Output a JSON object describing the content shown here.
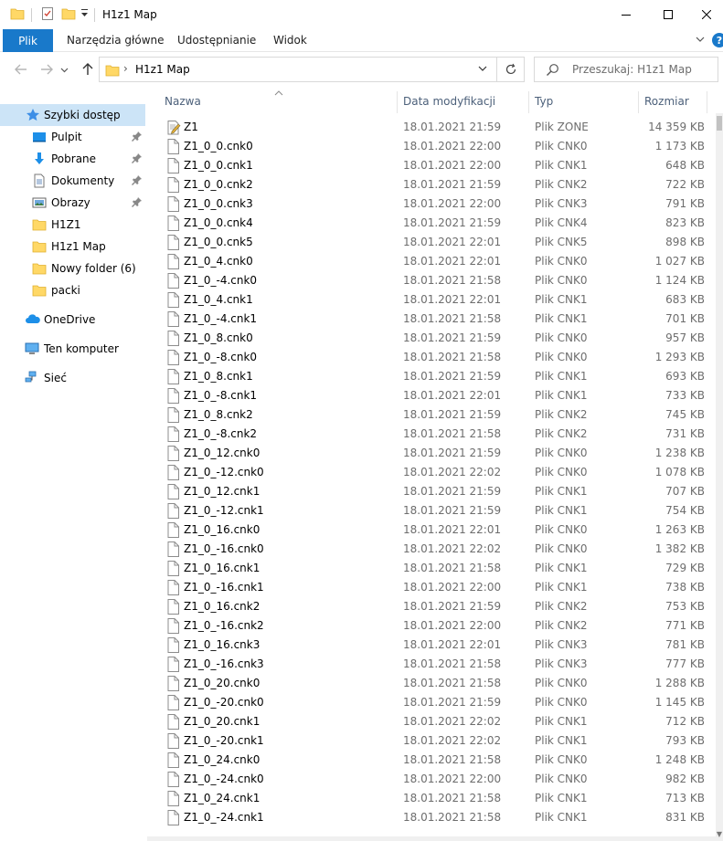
{
  "window": {
    "title": "H1z1 Map",
    "minimize_label": "Minimalizuj",
    "maximize_label": "Maksymalizuj",
    "close_label": "Zamknij"
  },
  "ribbon": {
    "tabs": [
      "Plik",
      "Narzędzia główne",
      "Udostępnianie",
      "Widok"
    ]
  },
  "address": {
    "path": "H1z1 Map"
  },
  "search": {
    "placeholder": "Przeszukaj: H1z1 Map"
  },
  "sidebar": {
    "items": [
      {
        "label": "Szybki dostęp",
        "icon": "star-icon",
        "pinned": false,
        "selected": true
      },
      {
        "label": "Pulpit",
        "icon": "desktop-icon",
        "pinned": true
      },
      {
        "label": "Pobrane",
        "icon": "download-icon",
        "pinned": true
      },
      {
        "label": "Dokumenty",
        "icon": "documents-icon",
        "pinned": true
      },
      {
        "label": "Obrazy",
        "icon": "pictures-icon",
        "pinned": true
      },
      {
        "label": "H1Z1",
        "icon": "folder-icon",
        "pinned": false
      },
      {
        "label": "H1z1 Map",
        "icon": "folder-icon",
        "pinned": false
      },
      {
        "label": "Nowy folder (6)",
        "icon": "folder-icon",
        "pinned": false
      },
      {
        "label": "packi",
        "icon": "folder-icon",
        "pinned": false
      },
      {
        "label": "OneDrive",
        "icon": "cloud-icon",
        "pinned": false
      },
      {
        "label": "Ten komputer",
        "icon": "computer-icon",
        "pinned": false
      },
      {
        "label": "Sieć",
        "icon": "network-icon",
        "pinned": false
      }
    ]
  },
  "columns": {
    "name": "Nazwa",
    "date": "Data modyfikacji",
    "type": "Typ",
    "size": "Rozmiar"
  },
  "files": [
    {
      "name": "Z1",
      "date": "18.01.2021 21:59",
      "type": "Plik ZONE",
      "size": "14 359 KB",
      "icon": "zone-file-icon"
    },
    {
      "name": "Z1_0_0.cnk0",
      "date": "18.01.2021 22:00",
      "type": "Plik CNK0",
      "size": "1 173 KB"
    },
    {
      "name": "Z1_0_0.cnk1",
      "date": "18.01.2021 22:00",
      "type": "Plik CNK1",
      "size": "648 KB"
    },
    {
      "name": "Z1_0_0.cnk2",
      "date": "18.01.2021 21:59",
      "type": "Plik CNK2",
      "size": "722 KB"
    },
    {
      "name": "Z1_0_0.cnk3",
      "date": "18.01.2021 22:00",
      "type": "Plik CNK3",
      "size": "791 KB"
    },
    {
      "name": "Z1_0_0.cnk4",
      "date": "18.01.2021 21:59",
      "type": "Plik CNK4",
      "size": "823 KB"
    },
    {
      "name": "Z1_0_0.cnk5",
      "date": "18.01.2021 22:01",
      "type": "Plik CNK5",
      "size": "898 KB"
    },
    {
      "name": "Z1_0_4.cnk0",
      "date": "18.01.2021 22:01",
      "type": "Plik CNK0",
      "size": "1 027 KB"
    },
    {
      "name": "Z1_0_-4.cnk0",
      "date": "18.01.2021 21:58",
      "type": "Plik CNK0",
      "size": "1 124 KB"
    },
    {
      "name": "Z1_0_4.cnk1",
      "date": "18.01.2021 22:01",
      "type": "Plik CNK1",
      "size": "683 KB"
    },
    {
      "name": "Z1_0_-4.cnk1",
      "date": "18.01.2021 21:58",
      "type": "Plik CNK1",
      "size": "701 KB"
    },
    {
      "name": "Z1_0_8.cnk0",
      "date": "18.01.2021 21:59",
      "type": "Plik CNK0",
      "size": "957 KB"
    },
    {
      "name": "Z1_0_-8.cnk0",
      "date": "18.01.2021 21:58",
      "type": "Plik CNK0",
      "size": "1 293 KB"
    },
    {
      "name": "Z1_0_8.cnk1",
      "date": "18.01.2021 21:59",
      "type": "Plik CNK1",
      "size": "693 KB"
    },
    {
      "name": "Z1_0_-8.cnk1",
      "date": "18.01.2021 22:01",
      "type": "Plik CNK1",
      "size": "733 KB"
    },
    {
      "name": "Z1_0_8.cnk2",
      "date": "18.01.2021 21:59",
      "type": "Plik CNK2",
      "size": "745 KB"
    },
    {
      "name": "Z1_0_-8.cnk2",
      "date": "18.01.2021 21:58",
      "type": "Plik CNK2",
      "size": "731 KB"
    },
    {
      "name": "Z1_0_12.cnk0",
      "date": "18.01.2021 21:59",
      "type": "Plik CNK0",
      "size": "1 238 KB"
    },
    {
      "name": "Z1_0_-12.cnk0",
      "date": "18.01.2021 22:02",
      "type": "Plik CNK0",
      "size": "1 078 KB"
    },
    {
      "name": "Z1_0_12.cnk1",
      "date": "18.01.2021 21:59",
      "type": "Plik CNK1",
      "size": "707 KB"
    },
    {
      "name": "Z1_0_-12.cnk1",
      "date": "18.01.2021 21:59",
      "type": "Plik CNK1",
      "size": "754 KB"
    },
    {
      "name": "Z1_0_16.cnk0",
      "date": "18.01.2021 22:01",
      "type": "Plik CNK0",
      "size": "1 263 KB"
    },
    {
      "name": "Z1_0_-16.cnk0",
      "date": "18.01.2021 22:02",
      "type": "Plik CNK0",
      "size": "1 382 KB"
    },
    {
      "name": "Z1_0_16.cnk1",
      "date": "18.01.2021 21:58",
      "type": "Plik CNK1",
      "size": "729 KB"
    },
    {
      "name": "Z1_0_-16.cnk1",
      "date": "18.01.2021 22:00",
      "type": "Plik CNK1",
      "size": "738 KB"
    },
    {
      "name": "Z1_0_16.cnk2",
      "date": "18.01.2021 21:59",
      "type": "Plik CNK2",
      "size": "753 KB"
    },
    {
      "name": "Z1_0_-16.cnk2",
      "date": "18.01.2021 22:00",
      "type": "Plik CNK2",
      "size": "771 KB"
    },
    {
      "name": "Z1_0_16.cnk3",
      "date": "18.01.2021 22:01",
      "type": "Plik CNK3",
      "size": "781 KB"
    },
    {
      "name": "Z1_0_-16.cnk3",
      "date": "18.01.2021 21:58",
      "type": "Plik CNK3",
      "size": "777 KB"
    },
    {
      "name": "Z1_0_20.cnk0",
      "date": "18.01.2021 21:58",
      "type": "Plik CNK0",
      "size": "1 288 KB"
    },
    {
      "name": "Z1_0_-20.cnk0",
      "date": "18.01.2021 21:59",
      "type": "Plik CNK0",
      "size": "1 145 KB"
    },
    {
      "name": "Z1_0_20.cnk1",
      "date": "18.01.2021 22:02",
      "type": "Plik CNK1",
      "size": "712 KB"
    },
    {
      "name": "Z1_0_-20.cnk1",
      "date": "18.01.2021 22:02",
      "type": "Plik CNK1",
      "size": "793 KB"
    },
    {
      "name": "Z1_0_24.cnk0",
      "date": "18.01.2021 21:58",
      "type": "Plik CNK0",
      "size": "1 248 KB"
    },
    {
      "name": "Z1_0_-24.cnk0",
      "date": "18.01.2021 22:00",
      "type": "Plik CNK0",
      "size": "982 KB"
    },
    {
      "name": "Z1_0_24.cnk1",
      "date": "18.01.2021 21:58",
      "type": "Plik CNK1",
      "size": "713 KB"
    },
    {
      "name": "Z1_0_-24.cnk1",
      "date": "18.01.2021 21:58",
      "type": "Plik CNK1",
      "size": "831 KB"
    }
  ],
  "colors": {
    "accent": "#1979ca",
    "selected": "#cce4f7",
    "folder": "#ffd866",
    "header_text": "#4c607a"
  }
}
